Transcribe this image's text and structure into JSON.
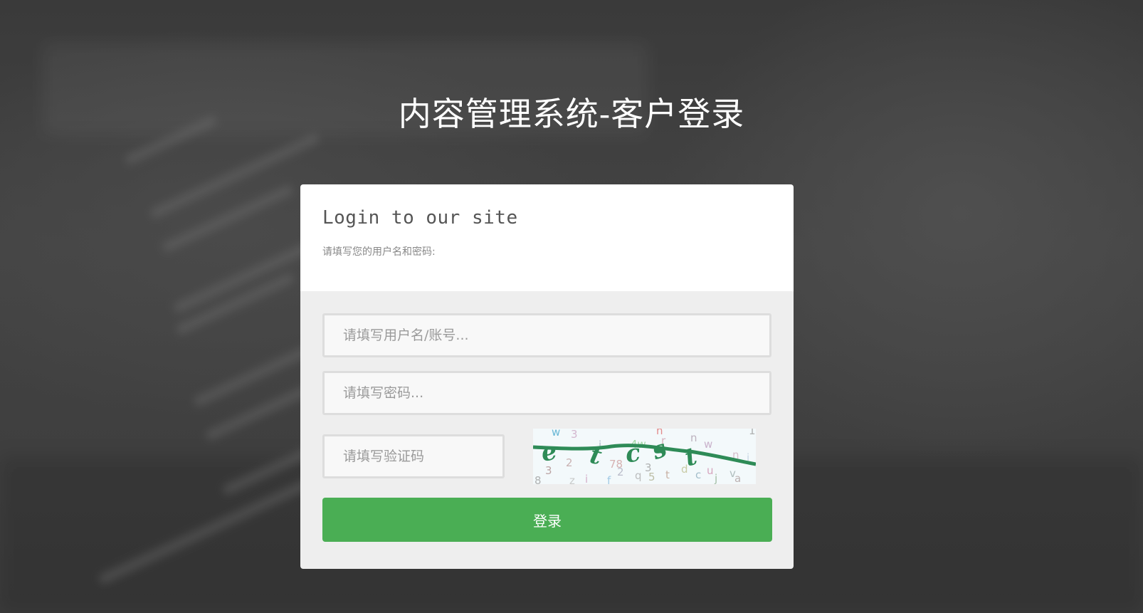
{
  "page": {
    "title": "内容管理系统-客户登录"
  },
  "login_card": {
    "heading": "Login to our site",
    "description": "请填写您的用户名和密码:"
  },
  "form": {
    "username_placeholder": "请填写用户名/账号...",
    "password_placeholder": "请填写密码...",
    "captcha_placeholder": "请填写验证码",
    "submit_label": "登录"
  },
  "captcha": {
    "text": "etcst",
    "noise_chars": [
      "w",
      "3",
      "n",
      "i",
      "4w",
      "r",
      "n",
      "w",
      "1",
      "3",
      "2",
      "78",
      "q",
      "5",
      "3",
      "t",
      "d",
      "c",
      "u",
      "j",
      "a",
      "v",
      "z",
      "i",
      "f",
      "2",
      "8",
      "i",
      "c"
    ]
  },
  "colors": {
    "button": "#4aae54",
    "captcha_line": "#2e8b57"
  }
}
